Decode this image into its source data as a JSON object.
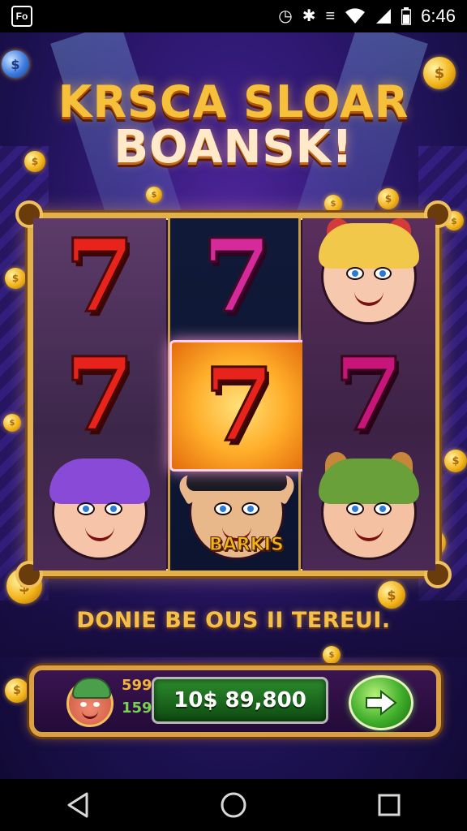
{
  "status_bar": {
    "app_icon_text": "Fo",
    "icons": [
      "alarm-icon",
      "bluetooth-icon",
      "vibrate-icon",
      "wifi-icon",
      "signal-icon",
      "battery-icon"
    ],
    "time": "6:46"
  },
  "game": {
    "title_line1": "KRSCA SLOAR",
    "title_line2": "BOANSK!",
    "reels": [
      [
        "seven-red",
        "seven-red",
        "character-purple-hair"
      ],
      [
        "seven-pink",
        "seven-red-highlighted",
        "character-elf"
      ],
      [
        "character-blonde-cat-ears",
        "seven-magenta",
        "character-green-hat"
      ]
    ],
    "symbol_seven": "7",
    "symbol_label": "BARKIS",
    "subtitle": "DONIE BE OUS II TEREUI.",
    "colors": {
      "gold": "#e4b04a",
      "background": "#321a78",
      "seven_red": "#e8231c",
      "seven_pink": "#d42a9a",
      "balance_green": "#2c8a2c"
    }
  },
  "bottom_panel": {
    "bet_top": "599",
    "bet_bottom": "159",
    "balance": "10$ 89,800",
    "go_button_icon": "arrow-right-icon"
  },
  "nav_bar": {
    "buttons": [
      "back-icon",
      "home-icon",
      "recents-icon"
    ]
  }
}
